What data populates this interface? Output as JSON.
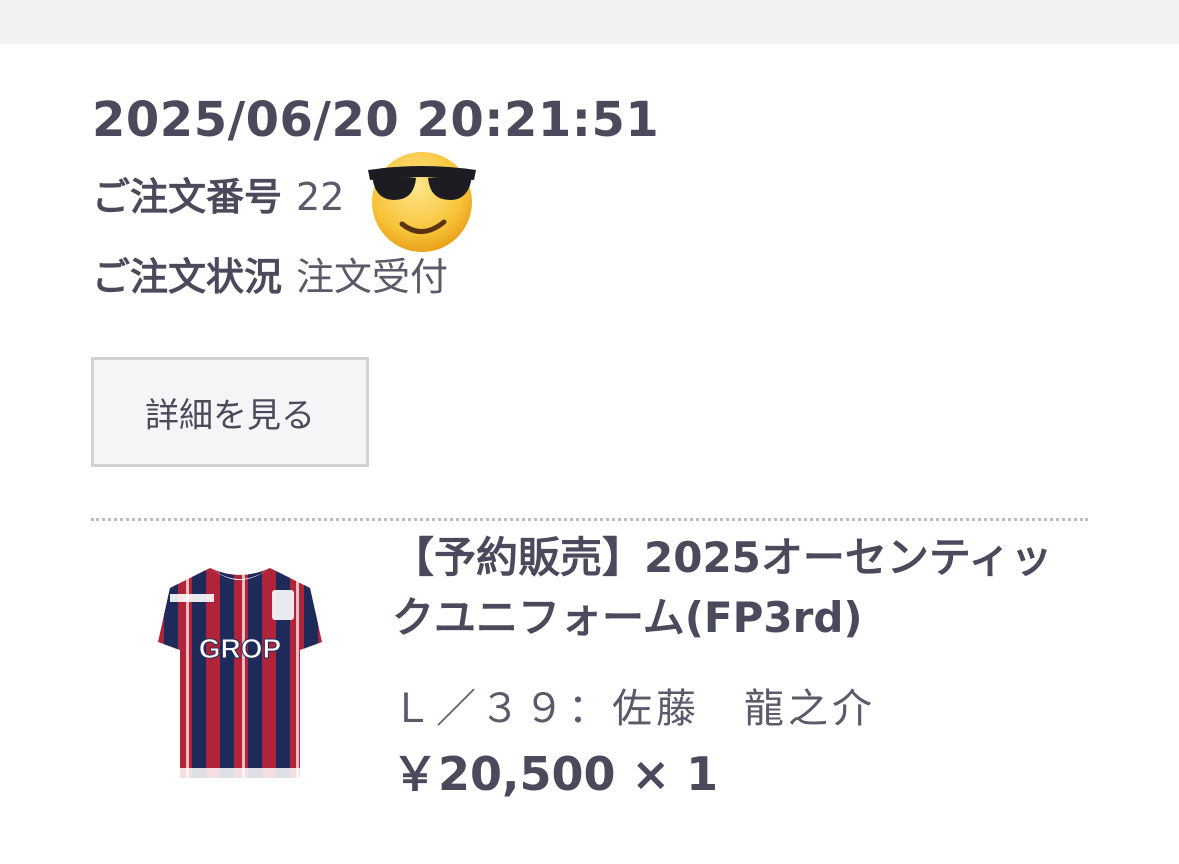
{
  "order": {
    "datetime": "2025/06/20 20:21:51",
    "number_label": "ご注文番号",
    "number_value_visible": "22",
    "status_label": "ご注文状況",
    "status_value": "注文受付",
    "detail_button_label": "詳細を見る"
  },
  "overlay": {
    "emoji_icon": "sunglasses-emoji-icon"
  },
  "item": {
    "title": "【予約販売】2025オーセンティックユニフォーム(FP3rd)",
    "option": "Ｌ／３９：佐藤　龍之介",
    "price": "￥20,500",
    "quantity": "× 1",
    "image_icon": "jersey-image",
    "jersey_text": "GROP"
  },
  "colors": {
    "text": "#4a4a5c",
    "topbar": "#f2f2f3",
    "button_bg": "#f4f5f7",
    "button_border": "#d2d2d6",
    "jersey_red": "#b0243a",
    "jersey_navy": "#1e2a5a"
  }
}
